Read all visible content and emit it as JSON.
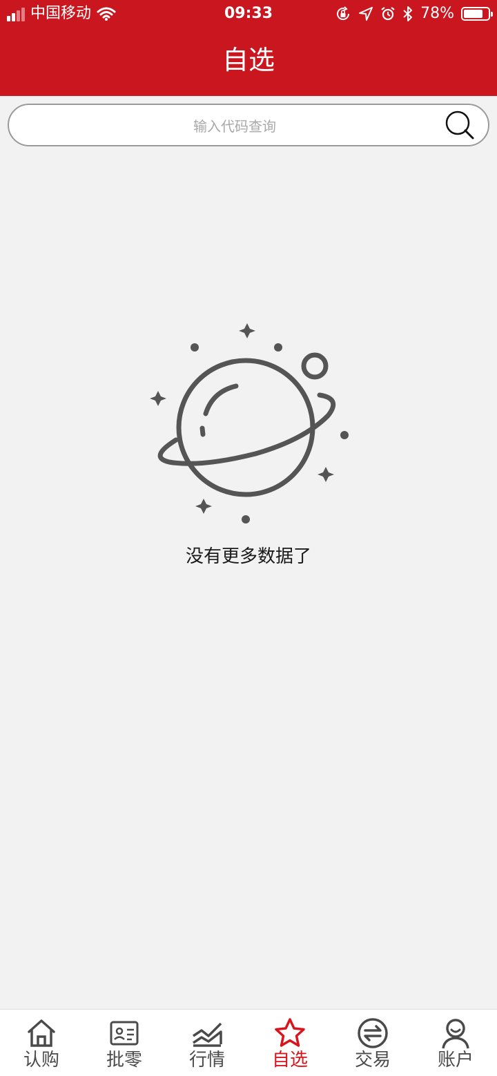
{
  "status_bar": {
    "carrier": "中国移动",
    "time": "09:33",
    "battery_text": "78%",
    "battery_level": 0.78
  },
  "header": {
    "title": "自选"
  },
  "search": {
    "placeholder": "输入代码查询"
  },
  "empty_state": {
    "message": "没有更多数据了"
  },
  "tabbar": {
    "items": [
      {
        "label": "认购",
        "icon": "home-icon",
        "active": false
      },
      {
        "label": "批零",
        "icon": "id-card-icon",
        "active": false
      },
      {
        "label": "行情",
        "icon": "chart-icon",
        "active": false
      },
      {
        "label": "自选",
        "icon": "star-icon",
        "active": true
      },
      {
        "label": "交易",
        "icon": "exchange-icon",
        "active": false
      },
      {
        "label": "账户",
        "icon": "user-icon",
        "active": false
      }
    ]
  },
  "colors": {
    "brand": "#c9161f",
    "active_tab": "#d8141c",
    "background": "#f2f2f2"
  }
}
